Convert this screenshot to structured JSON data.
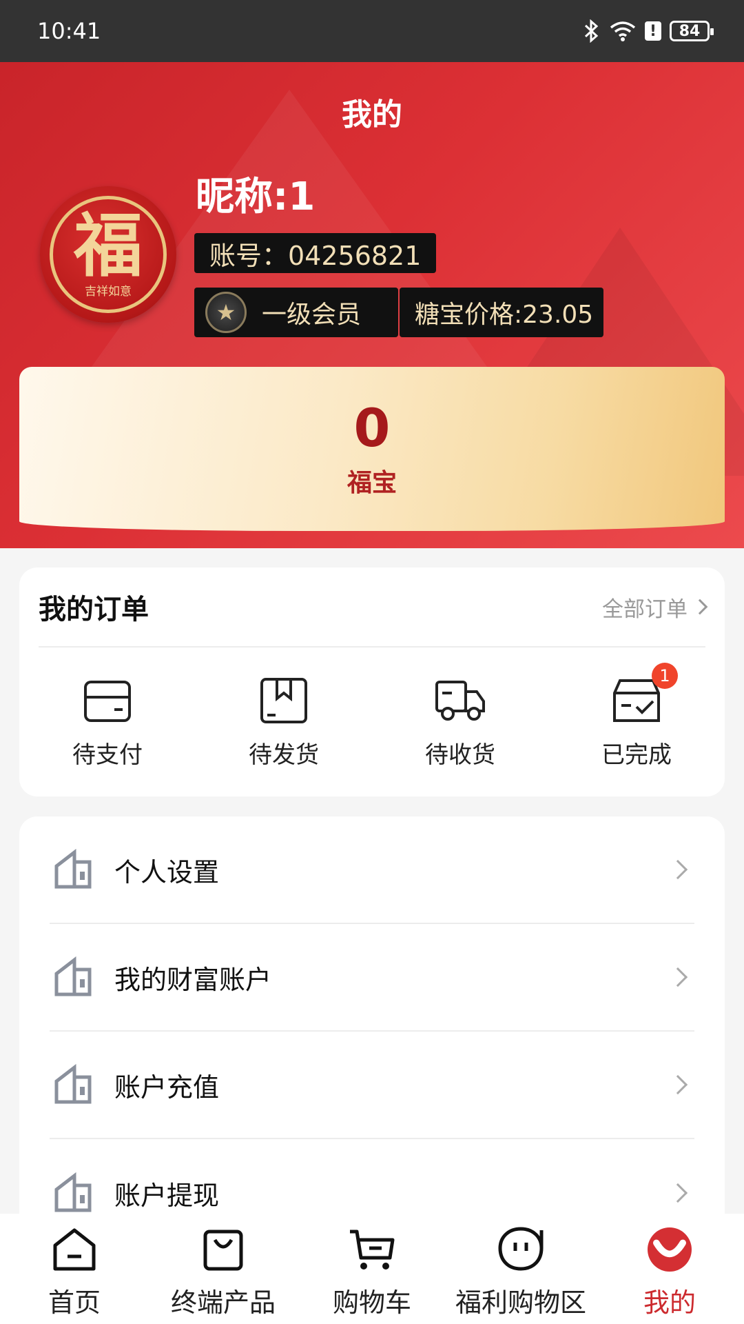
{
  "status_bar": {
    "time": "10:41",
    "battery": "84",
    "alert": "!"
  },
  "header": {
    "title": "我的",
    "avatar_char": "福",
    "avatar_caption": "吉祥如意",
    "nickname": "昵称:1",
    "account": "账号：04256821",
    "member_level": "一级会员",
    "price": "糖宝价格:23.05"
  },
  "balance": {
    "value": "0",
    "label": "福宝"
  },
  "orders": {
    "title": "我的订单",
    "all_label": "全部订单",
    "items": [
      {
        "label": "待支付",
        "icon": "wallet-icon"
      },
      {
        "label": "待发货",
        "icon": "package-icon"
      },
      {
        "label": "待收货",
        "icon": "truck-icon"
      },
      {
        "label": "已完成",
        "icon": "completed-box-icon",
        "badge": "1"
      }
    ]
  },
  "menu": [
    {
      "label": "个人设置",
      "icon": "house-icon"
    },
    {
      "label": "我的财富账户",
      "icon": "house-icon"
    },
    {
      "label": "账户充值",
      "icon": "house-icon"
    },
    {
      "label": "账户提现",
      "icon": "house-icon"
    }
  ],
  "tabs": [
    {
      "label": "首页",
      "icon": "home-icon"
    },
    {
      "label": "终端产品",
      "icon": "shopping-bag-icon"
    },
    {
      "label": "购物车",
      "icon": "cart-icon"
    },
    {
      "label": "福利购物区",
      "icon": "face-icon"
    },
    {
      "label": "我的",
      "icon": "me-icon",
      "active": true
    }
  ],
  "colors": {
    "brand_red": "#d42f33",
    "gold": "#f2dfb7",
    "badge": "#f0442b"
  }
}
